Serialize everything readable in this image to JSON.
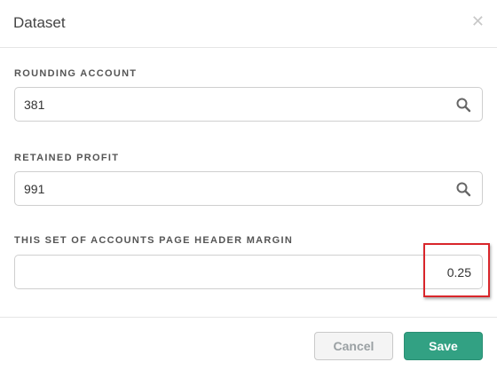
{
  "dialog": {
    "title": "Dataset",
    "close_icon": "close-icon"
  },
  "fields": [
    {
      "label": "ROUNDING ACCOUNT",
      "value": "381",
      "icon": "search-icon"
    },
    {
      "label": "RETAINED PROFIT",
      "value": "991",
      "icon": "search-icon"
    },
    {
      "label": "THIS SET OF ACCOUNTS PAGE HEADER MARGIN",
      "value": "0.25"
    }
  ],
  "highlight_color": "#d9262b",
  "footer": {
    "cancel_label": "Cancel",
    "save_label": "Save",
    "save_color": "#32a183"
  }
}
